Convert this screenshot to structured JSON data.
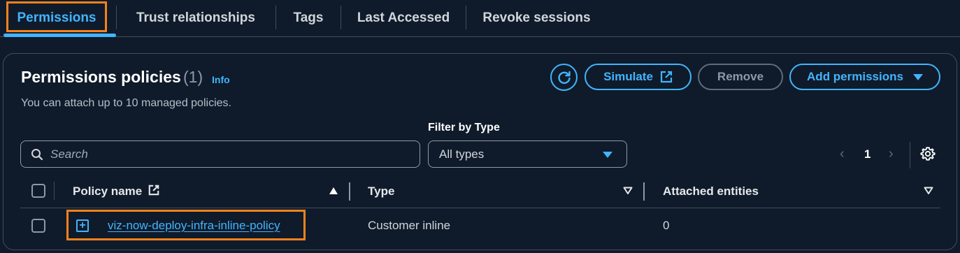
{
  "tabs": [
    {
      "label": "Permissions",
      "active": true
    },
    {
      "label": "Trust relationships"
    },
    {
      "label": "Tags"
    },
    {
      "label": "Last Accessed"
    },
    {
      "label": "Revoke sessions"
    }
  ],
  "panel": {
    "title": "Permissions policies",
    "count": "(1)",
    "info_link": "Info",
    "subtitle": "You can attach up to 10 managed policies.",
    "buttons": {
      "refresh_icon": "refresh-icon",
      "simulate": "Simulate",
      "remove": "Remove",
      "add_permissions": "Add permissions"
    }
  },
  "filters": {
    "search_placeholder": "Search",
    "filter_label": "Filter by Type",
    "type_selected": "All types"
  },
  "pagination": {
    "current_page": "1"
  },
  "table": {
    "columns": [
      "Policy name",
      "Type",
      "Attached entities"
    ],
    "rows": [
      {
        "policy_name": "viz-now-deploy-infra-inline-policy",
        "type": "Customer inline",
        "attached_entities": "0"
      }
    ]
  },
  "colors": {
    "accent": "#42b4ff",
    "highlight": "#f7821b",
    "background": "#0f1b2a"
  }
}
